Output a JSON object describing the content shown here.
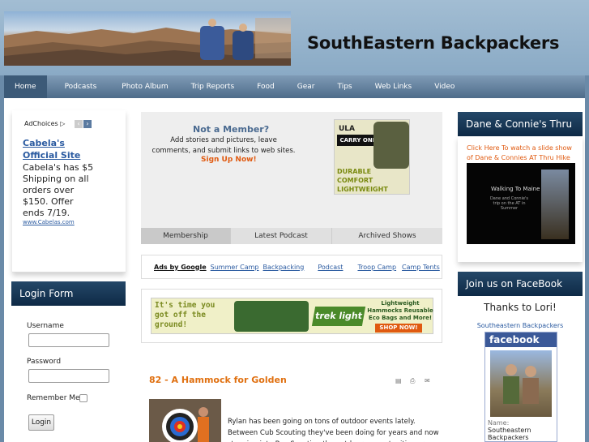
{
  "header": {
    "title": "SouthEastern Backpackers"
  },
  "nav": [
    "Home",
    "Podcasts",
    "Photo Album",
    "Trip Reports",
    "Food",
    "Gear",
    "Tips",
    "Web Links",
    "Video"
  ],
  "ad": {
    "adchoices": "AdChoices",
    "title": "Cabela's Official Site",
    "text": "Cabela's has $5 Shipping on all orders over $150. Offer ends 7/19.",
    "url": "www.Cabelas.com"
  },
  "login": {
    "title": "Login Form",
    "username": "Username",
    "password": "Password",
    "remember": "Remember Me",
    "button": "Login"
  },
  "member": {
    "title": "Not a Member?",
    "text": "Add stories and pictures, leave comments, and submit links to web sites.",
    "signup": "Sign Up Now!",
    "ula_brand": "ULA",
    "ula_model": "CARRY ONE",
    "ula_tag1": "DURABLE",
    "ula_tag2": "COMFORT",
    "ula_tag3": "LIGHTWEIGHT"
  },
  "tabs": [
    "Membership",
    "Latest Podcast",
    "Archived Shows"
  ],
  "adsbar": {
    "label": "Ads by Google",
    "links": [
      "Summer Camp",
      "Backpacking",
      "Podcast",
      "Troop Camp",
      "Camp Tents"
    ]
  },
  "promo": {
    "slogan": "It's time you got off the ground!",
    "brand": "trek light",
    "tagline": "Lightweight Hammocks Reusable Eco Bags and More!",
    "shop": "SHOP NOW!"
  },
  "article": {
    "title": "82 - A Hammock for Golden",
    "text": "Rylan has been going on tons of outdoor events lately. Between Cub Scouting they've been doing for years and now stepping into Boy Scouting the outdoors opportunities are"
  },
  "right1": {
    "title": "Dane & Connie's Thru Hike",
    "link": "Click Here To watch a slide show of Dane & Connies AT Thru Hike",
    "video_title": "Walking To Maine",
    "video_sub": "Dane and Connie's trip on the AT in Summer"
  },
  "right2": {
    "title": "Join us on FaceBook",
    "thanks": "Thanks to Lori!",
    "page": "Southeastern Backpackers",
    "fb": "facebook",
    "name_label": "Name:",
    "name": "Southeastern Backpackers"
  },
  "colors": {
    "nav": "#4e6c8a",
    "title_bar": "#0e2a46",
    "accent_orange": "#e05a10",
    "article_title": "#e07010",
    "link_blue": "#2a5aa0"
  }
}
